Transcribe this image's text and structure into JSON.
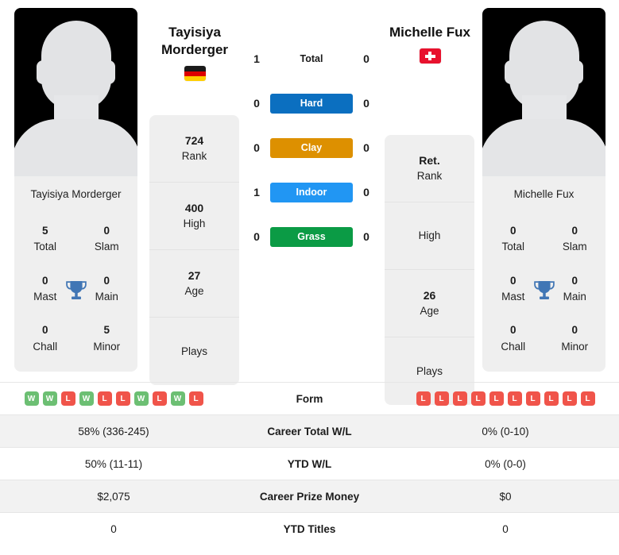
{
  "players": {
    "left": {
      "name": "Tayisiya Morderger",
      "display_name_line1": "Tayisiya",
      "display_name_line2": "Morderger",
      "country": "Germany",
      "flag": "flag-de",
      "photo_alt": "player-photo-placeholder",
      "titles": [
        {
          "value": "5",
          "label": "Total"
        },
        {
          "value": "0",
          "label": "Slam"
        },
        {
          "value": "0",
          "label": "Mast"
        },
        {
          "value": "0",
          "label": "Main"
        },
        {
          "value": "0",
          "label": "Chall"
        },
        {
          "value": "5",
          "label": "Minor"
        }
      ],
      "info": [
        {
          "value": "724",
          "label": "Rank"
        },
        {
          "value": "400",
          "label": "High"
        },
        {
          "value": "27",
          "label": "Age"
        },
        {
          "value": "",
          "label": "Plays"
        }
      ],
      "form": [
        "W",
        "W",
        "L",
        "W",
        "L",
        "L",
        "W",
        "L",
        "W",
        "L"
      ],
      "career_total_wl": "58% (336-245)",
      "ytd_wl": "50% (11-11)",
      "career_prize_money": "$2,075",
      "ytd_titles": "0"
    },
    "right": {
      "name": "Michelle Fux",
      "display_name_line1": "Michelle Fux",
      "display_name_line2": "",
      "country": "Switzerland",
      "flag": "flag-ch",
      "photo_alt": "player-photo-placeholder",
      "titles": [
        {
          "value": "0",
          "label": "Total"
        },
        {
          "value": "0",
          "label": "Slam"
        },
        {
          "value": "0",
          "label": "Mast"
        },
        {
          "value": "0",
          "label": "Main"
        },
        {
          "value": "0",
          "label": "Chall"
        },
        {
          "value": "0",
          "label": "Minor"
        }
      ],
      "info": [
        {
          "value": "Ret.",
          "label": "Rank"
        },
        {
          "value": "",
          "label": "High"
        },
        {
          "value": "26",
          "label": "Age"
        },
        {
          "value": "",
          "label": "Plays"
        }
      ],
      "form": [
        "L",
        "L",
        "L",
        "L",
        "L",
        "L",
        "L",
        "L",
        "L",
        "L"
      ],
      "career_total_wl": "0% (0-10)",
      "ytd_wl": "0% (0-0)",
      "career_prize_money": "$0",
      "ytd_titles": "0"
    }
  },
  "head_to_head": [
    {
      "label": "Total",
      "left": "1",
      "right": "0",
      "style": "plain",
      "color": ""
    },
    {
      "label": "Hard",
      "left": "0",
      "right": "0",
      "style": "badge",
      "color": "#0b6fc0"
    },
    {
      "label": "Clay",
      "left": "0",
      "right": "0",
      "style": "badge",
      "color": "#dd9000"
    },
    {
      "label": "Indoor",
      "left": "1",
      "right": "0",
      "style": "badge",
      "color": "#2196f3"
    },
    {
      "label": "Grass",
      "left": "0",
      "right": "0",
      "style": "badge",
      "color": "#0b9b45"
    }
  ],
  "table": {
    "rows": [
      {
        "key": "form",
        "label": "Form",
        "left": "",
        "right": ""
      },
      {
        "key": "ctwl",
        "label": "Career Total W/L",
        "left": "58% (336-245)",
        "right": "0% (0-10)"
      },
      {
        "key": "ytdwl",
        "label": "YTD W/L",
        "left": "50% (11-11)",
        "right": "0% (0-0)"
      },
      {
        "key": "prize",
        "label": "Career Prize Money",
        "left": "$2,075",
        "right": "$0"
      },
      {
        "key": "titles",
        "label": "YTD Titles",
        "left": "0",
        "right": "0"
      }
    ]
  },
  "colors": {
    "win": "#6cbf73",
    "loss": "#f0544a",
    "hard": "#0b6fc0",
    "clay": "#dd9000",
    "indoor": "#2196f3",
    "grass": "#0b9b45",
    "card_bg": "#efefef",
    "trophy": "#4176b5"
  },
  "icons": {
    "trophy": "trophy-icon",
    "flag_left": "german-flag-icon",
    "flag_right": "swiss-flag-icon"
  }
}
